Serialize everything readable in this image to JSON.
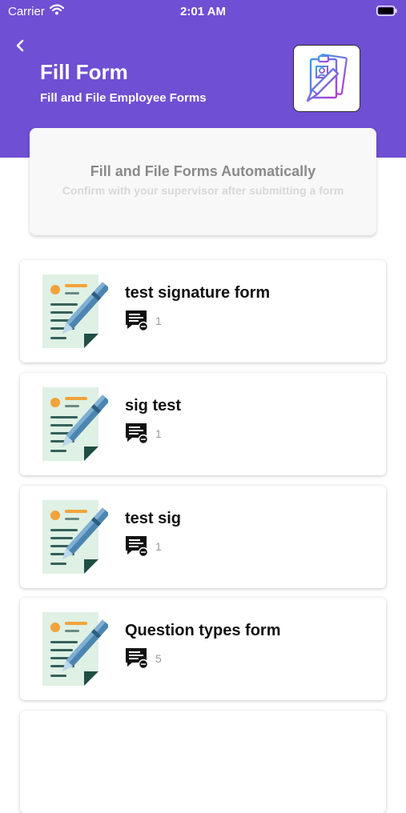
{
  "status_bar": {
    "carrier": "Carrier",
    "time": "2:01 AM"
  },
  "header": {
    "title": "Fill Form",
    "subtitle": "Fill and File Employee Forms",
    "illustration_icon": "clipboard-form-icon",
    "background_color": "#6f4fd3"
  },
  "info_card": {
    "title": "Fill and File Forms Automatically",
    "description": "Confirm with your supervisor after submitting a form"
  },
  "forms": [
    {
      "name": "test signature form",
      "submissions": "1"
    },
    {
      "name": "sig test",
      "submissions": "1"
    },
    {
      "name": "test sig",
      "submissions": "1"
    },
    {
      "name": "Question types form",
      "submissions": "5"
    }
  ]
}
